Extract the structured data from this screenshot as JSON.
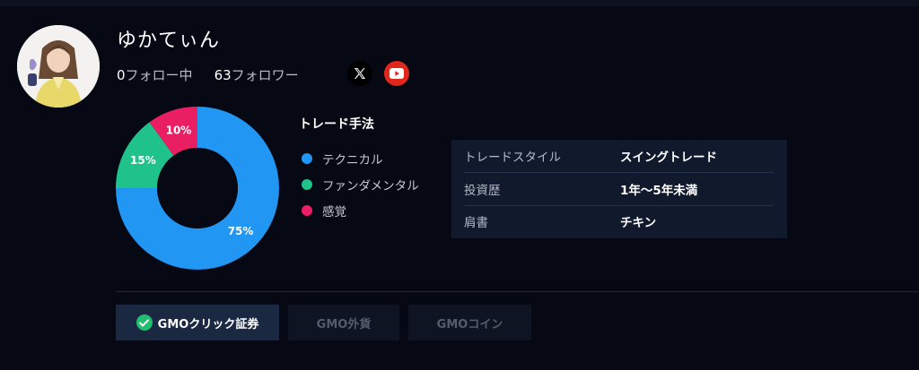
{
  "profile": {
    "name": "ゆかてぃん",
    "following_count": "0",
    "following_label": "フォロー中",
    "followers_count": "63",
    "followers_label": "フォロワー"
  },
  "social": {
    "x_icon": "x-logo-icon",
    "youtube_icon": "youtube-icon"
  },
  "chart_data": {
    "type": "pie",
    "title": "トレード手法",
    "categories": [
      "テクニカル",
      "ファンダメンタル",
      "感覚"
    ],
    "values": [
      75,
      15,
      10
    ],
    "labels": [
      "75%",
      "15%",
      "10%"
    ],
    "colors": [
      "#2196f3",
      "#1fc28a",
      "#e91e63"
    ],
    "legend_position": "right"
  },
  "info": {
    "rows": [
      {
        "label": "トレードスタイル",
        "value": "スイングトレード"
      },
      {
        "label": "投資歴",
        "value": "1年〜5年未満"
      },
      {
        "label": "肩書",
        "value": "チキン"
      }
    ]
  },
  "tabs": [
    {
      "label": "GMOクリック証券",
      "active": true
    },
    {
      "label": "GMO外貨",
      "active": false
    },
    {
      "label": "GMOコイン",
      "active": false
    }
  ],
  "colors": {
    "background": "#060813",
    "panel": "#111a2d",
    "active_tab": "#1b2842",
    "check_green": "#1fbf6f",
    "youtube_red": "#e1261c"
  }
}
